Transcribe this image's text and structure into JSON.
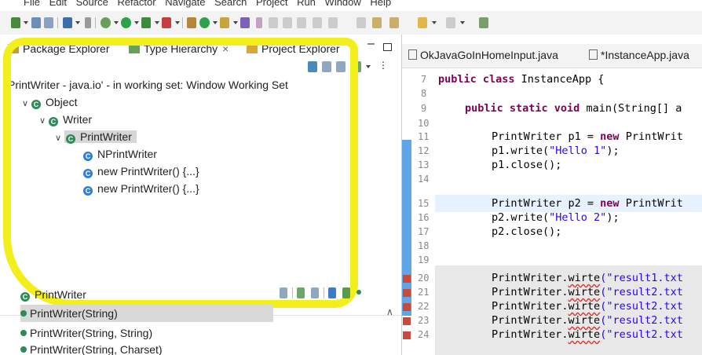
{
  "menu": [
    "File",
    "Edit",
    "Source",
    "Refactor",
    "Navigate",
    "Search",
    "Project",
    "Run",
    "Window",
    "Help"
  ],
  "left_tabs": {
    "package_explorer": "Package Explorer",
    "type_hierarchy": "Type Hierarchy",
    "project_explorer": "Project Explorer"
  },
  "hierarchy_status": "PrintWriter - java.io' - in working set: Window Working Set",
  "tree": {
    "object": "Object",
    "writer": "Writer",
    "printwriter": "PrintWriter",
    "nprintwriter": "NPrintWriter",
    "anon1": "new PrintWriter() {...}",
    "anon2": "new PrintWriter() {...}"
  },
  "members": {
    "title": "PrintWriter",
    "items": [
      "PrintWriter(String)",
      "PrintWriter(String, String)",
      "PrintWriter(String, Charset)"
    ]
  },
  "editor_tabs": [
    "OkJavaGoInHomeInput.java",
    "*InstanceApp.java"
  ],
  "line_numbers": [
    "7",
    "8",
    "9",
    "10",
    "11",
    "12",
    "13",
    "14",
    "15",
    "16",
    "17",
    "18",
    "19",
    "20",
    "21",
    "22",
    "23",
    "24"
  ],
  "code": {
    "l7_kw": "public class",
    "l7_rest": " InstanceApp {",
    "l9_kw": "public static void",
    "l9_rest": " main(String[] a",
    "l11_a": "PrintWriter p1 = ",
    "l11_kw": "new",
    "l11_b": " PrintWrit",
    "l12_a": "p1.write(",
    "l12_s": "\"Hello 1\"",
    "l12_b": ");",
    "l13": "p1.close();",
    "l15_a": "PrintWriter p2 = ",
    "l15_kw": "new",
    "l15_b": " PrintWrit",
    "l16_a": "p2.write(",
    "l16_s": "\"Hello 2\"",
    "l16_b": ");",
    "l17": "p2.close();",
    "l20_a": "PrintWriter.",
    "l20_m": "wirte",
    "l20_s": "(\"result1.txt",
    "l21_s": "(\"result2.txt",
    "l22_s": "(\"result2.txt",
    "l23_s": "(\"result2.txt",
    "l24_s": "(\"result2.txt"
  },
  "colors": {
    "highlight": "#f2ef1c",
    "keyword": "#7f0055",
    "string": "#2a00ff",
    "error_marker": "#c94a3c"
  }
}
